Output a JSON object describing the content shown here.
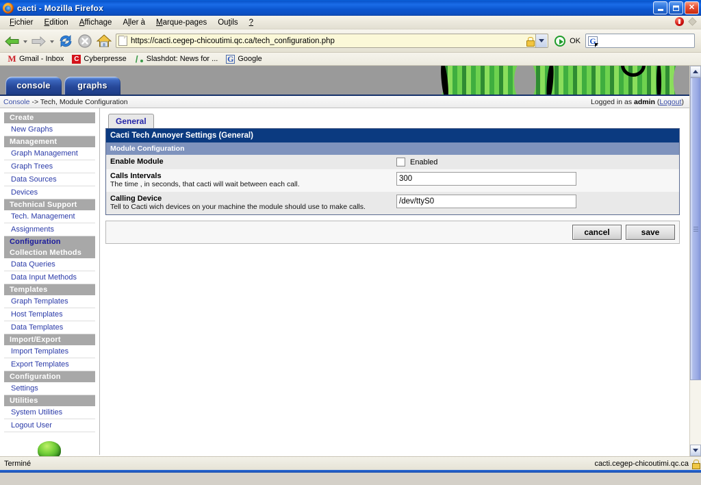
{
  "window": {
    "title": "cacti - Mozilla Firefox",
    "icon": "firefox-icon",
    "minimize_label": "Minimize",
    "maximize_label": "Maximize",
    "close_label": "Close"
  },
  "menubar": {
    "items": [
      {
        "label": "Fichier",
        "accel": "F"
      },
      {
        "label": "Edition",
        "accel": "E"
      },
      {
        "label": "Affichage",
        "accel": "A"
      },
      {
        "label": "Aller à",
        "accel": "A"
      },
      {
        "label": "Marque-pages",
        "accel": "M"
      },
      {
        "label": "Outils",
        "accel": "i"
      },
      {
        "label": "?",
        "accel": ""
      }
    ]
  },
  "toolbar": {
    "back_label": "Back",
    "forward_label": "Forward",
    "reload_label": "Reload",
    "stop_label": "Stop",
    "home_label": "Home",
    "url": "https://cacti.cegep-chicoutimi.qc.ca/tech_configuration.php",
    "go_label": "Go",
    "ok_label": "OK",
    "search_value": "",
    "search_placeholder": "",
    "search_engine": "G"
  },
  "bookmarks": [
    {
      "label": "Gmail - Inbox",
      "icon": "gmail-icon",
      "glyph": "M"
    },
    {
      "label": "Cyberpresse",
      "icon": "cyberpresse-icon",
      "glyph": "C"
    },
    {
      "label": "Slashdot: News for ...",
      "icon": "slashdot-icon",
      "glyph": ""
    },
    {
      "label": "Google",
      "icon": "google-icon",
      "glyph": "G"
    }
  ],
  "cacti": {
    "tabs": [
      {
        "label": "console",
        "active": true
      },
      {
        "label": "graphs",
        "active": false
      }
    ],
    "breadcrumb": {
      "link": "Console",
      "rest": " -> Tech, Module Configuration"
    },
    "login": {
      "prefix": "Logged in as ",
      "user": "admin",
      "logout_open": " (",
      "logout": "Logout",
      "logout_close": ")"
    },
    "sidebar": [
      {
        "type": "header",
        "label": "Create",
        "current": false
      },
      {
        "type": "link",
        "label": "New Graphs"
      },
      {
        "type": "header",
        "label": "Management",
        "current": false
      },
      {
        "type": "link",
        "label": "Graph Management"
      },
      {
        "type": "link",
        "label": "Graph Trees"
      },
      {
        "type": "link",
        "label": "Data Sources"
      },
      {
        "type": "link",
        "label": "Devices"
      },
      {
        "type": "header",
        "label": "Technical Support",
        "current": false
      },
      {
        "type": "link",
        "label": "Tech. Management"
      },
      {
        "type": "link",
        "label": "Assignments"
      },
      {
        "type": "header",
        "label": "Configuration",
        "current": true
      },
      {
        "type": "header",
        "label": "Collection Methods",
        "current": false
      },
      {
        "type": "link",
        "label": "Data Queries"
      },
      {
        "type": "link",
        "label": "Data Input Methods"
      },
      {
        "type": "header",
        "label": "Templates",
        "current": false
      },
      {
        "type": "link",
        "label": "Graph Templates"
      },
      {
        "type": "link",
        "label": "Host Templates"
      },
      {
        "type": "link",
        "label": "Data Templates"
      },
      {
        "type": "header",
        "label": "Import/Export",
        "current": false
      },
      {
        "type": "link",
        "label": "Import Templates"
      },
      {
        "type": "link",
        "label": "Export Templates"
      },
      {
        "type": "header",
        "label": "Configuration",
        "current": false
      },
      {
        "type": "link",
        "label": "Settings"
      },
      {
        "type": "header",
        "label": "Utilities",
        "current": false
      },
      {
        "type": "link",
        "label": "System Utilities"
      },
      {
        "type": "link",
        "label": "Logout User"
      }
    ],
    "content": {
      "tab_label": "General",
      "panel_title": "Cacti Tech Annoyer Settings (General)",
      "section_title": "Module Configuration",
      "fields": [
        {
          "name": "enable-module",
          "label": "Enable Module",
          "description": "",
          "control": "checkbox",
          "checkbox_label": "Enabled",
          "checked": false,
          "value": ""
        },
        {
          "name": "calls-intervals",
          "label": "Calls Intervals",
          "description": "The time , in seconds, that cacti will wait between each call.",
          "control": "text",
          "checkbox_label": "",
          "checked": false,
          "value": "300"
        },
        {
          "name": "calling-device",
          "label": "Calling Device",
          "description": "Tell to Cacti wich devices on your machine the module should use to make calls.",
          "control": "text",
          "checkbox_label": "",
          "checked": false,
          "value": "/dev/ttyS0"
        }
      ],
      "buttons": [
        {
          "name": "cancel-button",
          "label": "cancel"
        },
        {
          "name": "save-button",
          "label": "save"
        }
      ]
    }
  },
  "statusbar": {
    "message": "Terminé",
    "security_host": "cacti.cegep-chicoutimi.qc.ca"
  },
  "colors": {
    "titlebar": "#0a55cc",
    "panel_title": "#0b3a80",
    "panel_sub": "#7f93bd",
    "menu_head": "#a8a8a8",
    "link": "#2a3aa8",
    "current": "#1a1a9c"
  }
}
